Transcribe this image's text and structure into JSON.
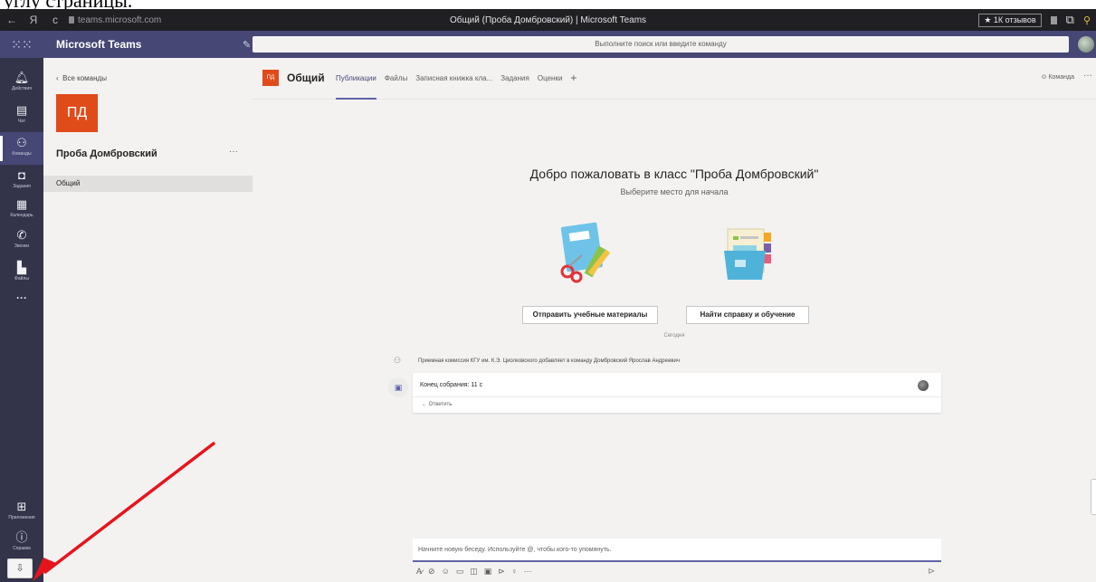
{
  "document": {
    "partial_text": "углу страницы."
  },
  "browser": {
    "nav_back": "←",
    "nav_yandex": "Я",
    "nav_reload": "c",
    "url": "teams.microsoft.com",
    "title": "Общий (Проба Домбровский) | Microsoft Teams",
    "feedback_badge": "★ 1К отзывов"
  },
  "teams": {
    "app_name": "Microsoft Teams",
    "search_placeholder": "Выполните поиск или введите команду"
  },
  "rail": {
    "items": [
      {
        "label": "Действия",
        "icon": "bell-icon"
      },
      {
        "label": "Чат",
        "icon": "chat-icon"
      },
      {
        "label": "Команды",
        "icon": "teams-icon"
      },
      {
        "label": "Задания",
        "icon": "assignments-icon"
      },
      {
        "label": "Календарь",
        "icon": "calendar-icon"
      },
      {
        "label": "Звонки",
        "icon": "phone-icon"
      },
      {
        "label": "Файлы",
        "icon": "file-icon"
      }
    ],
    "more": "···",
    "apps_label": "Приложения",
    "help_label": "Справка"
  },
  "panel": {
    "back_label": "Все команды",
    "team_initials": "ПД",
    "team_name": "Проба Домбровский",
    "more": "···",
    "channel": "Общий"
  },
  "channel": {
    "initials": "ПД",
    "name": "Общий",
    "tabs": [
      "Публикации",
      "Файлы",
      "Записная книжка кла...",
      "Задания",
      "Оценки"
    ],
    "add_tab": "+",
    "team_button": "⊙ Команда",
    "more": "···"
  },
  "welcome": {
    "title": "Добро пожаловать в класс \"Проба Домбровский\"",
    "subtitle": "Выберите место для начала",
    "action1": "Отправить учебные материалы",
    "action2": "Найти справку и обучение"
  },
  "feed": {
    "day": "Сегодня",
    "system_message": "Приемная комиссия КГУ им. К.Э. Циолковского добавляет в команду Домбровский Ярослав Андреевич",
    "meeting_title": "Конец собрания: 11 с",
    "reply": "← Ответить"
  },
  "composer": {
    "placeholder": "Начните новую беседу. Используйте @, чтобы кого-то упомянуть.",
    "more": "···"
  },
  "colors": {
    "teams_purple": "#464775",
    "rail": "#33344a",
    "team_tile": "#e04b1a",
    "accent": "#6264a7",
    "arrow": "#e8141c"
  }
}
